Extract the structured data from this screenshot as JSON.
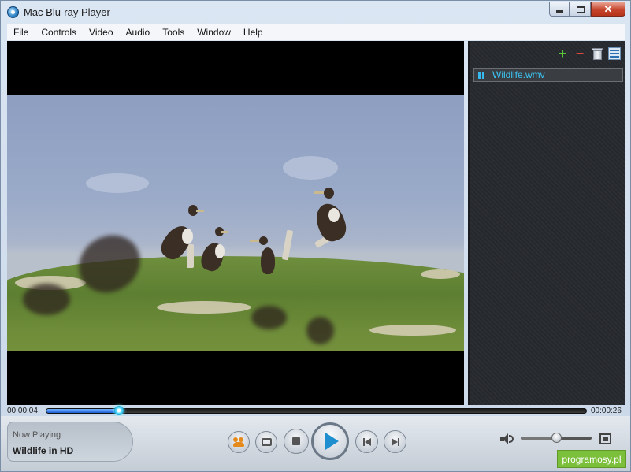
{
  "window": {
    "title": "Mac Blu-ray Player"
  },
  "menu": [
    "File",
    "Controls",
    "Video",
    "Audio",
    "Tools",
    "Window",
    "Help"
  ],
  "playlist": {
    "items": [
      {
        "name": "Wildlife.wmv",
        "state": "playing"
      }
    ]
  },
  "playback": {
    "current_time": "00:00:04",
    "total_time": "00:00:26",
    "progress_fraction": 0.135,
    "volume_fraction": 0.5
  },
  "now_playing": {
    "label": "Now Playing",
    "title": "Wildlife in HD"
  },
  "watermark": "programosy.pl",
  "colors": {
    "accent": "#3bc6f5",
    "progress": "#1e5fd4",
    "play": "#1f8fd0"
  },
  "icons": [
    "app-icon",
    "minimize-icon",
    "maximize-icon",
    "close-icon",
    "add-icon",
    "remove-icon",
    "trash-icon",
    "playlist-view-icon",
    "pause-icon",
    "people-icon",
    "folder-icon",
    "stop-icon",
    "play-icon",
    "previous-icon",
    "next-icon",
    "volume-icon",
    "fullscreen-icon"
  ]
}
